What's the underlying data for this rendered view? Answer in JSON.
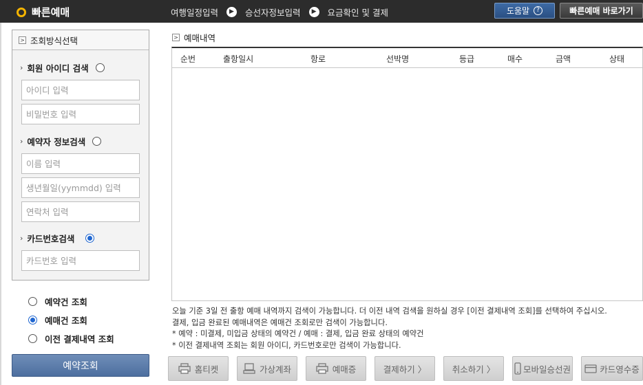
{
  "header": {
    "title": "빠른예매",
    "steps": [
      "여행일정입력",
      "승선자정보입력",
      "요금확인 및 결제"
    ],
    "help_label": "도움말",
    "help_icon": "?",
    "quick_label": "빠른예매 바로가기"
  },
  "search_panel": {
    "title": "조회방식선택",
    "member": {
      "label": "회원 아이디 검색",
      "selected": false,
      "id_placeholder": "아이디 입력",
      "pw_placeholder": "비밀번호 입력"
    },
    "reserver": {
      "label": "예약자 정보검색",
      "selected": false,
      "name_placeholder": "이름 입력",
      "birth_placeholder": "생년월일(yymmdd) 입력",
      "phone_placeholder": "연락처 입력"
    },
    "card": {
      "label": "카드번호검색",
      "selected": true,
      "card_placeholder": "카드번호 입력"
    }
  },
  "view_options": [
    {
      "label": "예약건 조회",
      "selected": false
    },
    {
      "label": "예매건 조회",
      "selected": true
    },
    {
      "label": "이전 결제내역 조회",
      "selected": false
    }
  ],
  "reserve_button": "예약조회",
  "history": {
    "title": "예매내역",
    "columns": [
      "순번",
      "출항일시",
      "항로",
      "선박명",
      "등급",
      "매수",
      "금액",
      "상태"
    ]
  },
  "notes": [
    "오늘 기준 3일 전 출항 예매 내역까지 검색이 가능합니다. 더 이전 내역 검색을 원하실 경우 [이전 결제내역 조회]를 선택하여 주십시오.",
    "결제, 입금 완료된 예매내역은 예매건 조회로만 검색이 가능합니다.",
    "* 예약 : 미결제, 미입금 상태의 예약건 / 예매 : 결제, 입금 완료 상태의 예약건",
    "* 이전 결제내역 조회는 회원 아이디, 카드번호로만 검색이 가능합니다."
  ],
  "actions": [
    {
      "label": "홈티켓",
      "icon": "printer-icon"
    },
    {
      "label": "가상계좌",
      "icon": "terminal-icon"
    },
    {
      "label": "예매증",
      "icon": "printer-icon"
    },
    {
      "label": "결제하기 〉",
      "icon": ""
    },
    {
      "label": "취소하기 〉",
      "icon": ""
    },
    {
      "label": "모바일승선권",
      "icon": "mobile-icon"
    },
    {
      "label": "카드영수증",
      "icon": "card-icon"
    }
  ]
}
